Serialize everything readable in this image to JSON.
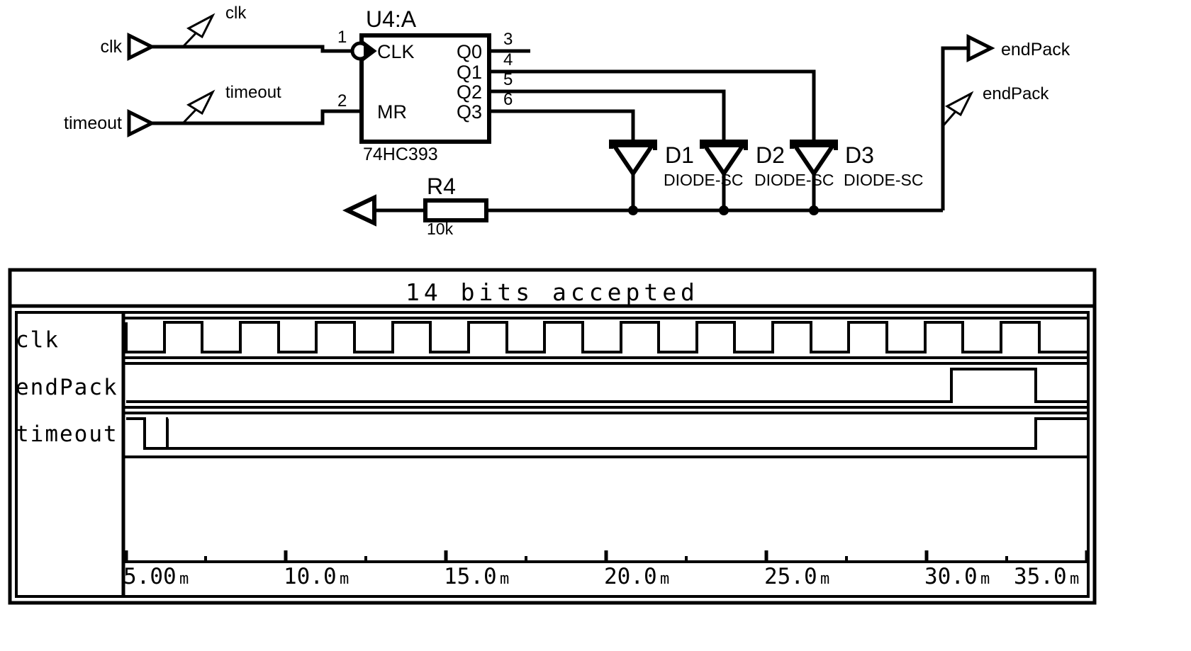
{
  "document": {
    "title": "74HC393 counter schematic with simulation timing diagram",
    "background_color": "#ffffff",
    "line_color": "#000000"
  },
  "schematic": {
    "ic": {
      "reference": "U4:A",
      "part_number": "74HC393",
      "input_pins": [
        {
          "name": "CLK",
          "number": "1",
          "inverted_clock": true
        },
        {
          "name": "MR",
          "number": "2",
          "inverted_clock": false
        }
      ],
      "output_pins": [
        {
          "name": "Q0",
          "number": "3"
        },
        {
          "name": "Q1",
          "number": "4"
        },
        {
          "name": "Q2",
          "number": "5"
        },
        {
          "name": "Q3",
          "number": "6"
        }
      ]
    },
    "input_terminals": [
      {
        "label": "clk",
        "net_label": "clk"
      },
      {
        "label": "timeout",
        "net_label": "timeout"
      }
    ],
    "output_terminals": [
      {
        "label": "endPack",
        "net_label": "endPack"
      }
    ],
    "diodes": [
      {
        "reference": "",
        "type": "DIODE-SC"
      },
      {
        "reference": "D1",
        "type": "DIODE-SC"
      },
      {
        "reference": "D2",
        "type": "DIODE-SC"
      },
      {
        "reference": "D3",
        "type": "DIODE-SC"
      }
    ],
    "resistor": {
      "reference": "R4",
      "value": "10k"
    }
  },
  "timing_diagram": {
    "title": "14 bits accepted",
    "signals": [
      {
        "name": "clk"
      },
      {
        "name": "endPack"
      },
      {
        "name": "timeout"
      }
    ],
    "time_axis": {
      "ticks": [
        "5.00",
        "10.0",
        "15.0",
        "20.0",
        "25.0",
        "30.0",
        "35.0"
      ],
      "unit": "m"
    }
  },
  "chart_data": {
    "type": "line",
    "title": "14 bits accepted",
    "xlabel": "",
    "ylabel": "",
    "xlim": [
      5.0,
      35.0
    ],
    "x_unit": "m",
    "x_ticks": [
      5.0,
      10.0,
      15.0,
      20.0,
      25.0,
      30.0,
      35.0
    ],
    "x_tick_labels": [
      "5.00m",
      "10.0m",
      "15.0m",
      "20.0m",
      "25.0m",
      "30.0m",
      "35.0m"
    ],
    "grid": false,
    "legend": "left-axis-labels",
    "series": [
      {
        "name": "clk",
        "type": "digital",
        "description": "Square wave clock, 14 rising edges across the window",
        "transitions": [
          {
            "t": 5.0,
            "level": 1
          },
          {
            "t": 6.07,
            "level": 0
          },
          {
            "t": 7.14,
            "level": 1
          },
          {
            "t": 8.21,
            "level": 0
          },
          {
            "t": 9.29,
            "level": 1
          },
          {
            "t": 10.36,
            "level": 0
          },
          {
            "t": 11.43,
            "level": 1
          },
          {
            "t": 12.5,
            "level": 0
          },
          {
            "t": 13.57,
            "level": 1
          },
          {
            "t": 14.64,
            "level": 0
          },
          {
            "t": 15.71,
            "level": 1
          },
          {
            "t": 16.79,
            "level": 0
          },
          {
            "t": 17.86,
            "level": 1
          },
          {
            "t": 18.93,
            "level": 0
          },
          {
            "t": 20.0,
            "level": 1
          },
          {
            "t": 21.07,
            "level": 0
          },
          {
            "t": 22.14,
            "level": 1
          },
          {
            "t": 23.21,
            "level": 0
          },
          {
            "t": 24.29,
            "level": 1
          },
          {
            "t": 25.36,
            "level": 0
          },
          {
            "t": 26.43,
            "level": 1
          },
          {
            "t": 27.5,
            "level": 0
          },
          {
            "t": 28.57,
            "level": 1
          },
          {
            "t": 29.64,
            "level": 0
          },
          {
            "t": 30.71,
            "level": 1
          },
          {
            "t": 31.79,
            "level": 0
          },
          {
            "t": 32.86,
            "level": 1
          },
          {
            "t": 33.93,
            "level": 0
          },
          {
            "t": 35.0,
            "level": 1
          }
        ]
      },
      {
        "name": "endPack",
        "type": "digital",
        "description": "Low until approximately 31.3m, pulses high until 34.6m, then low",
        "transitions": [
          {
            "t": 5.0,
            "level": 0
          },
          {
            "t": 31.3,
            "level": 1
          },
          {
            "t": 34.6,
            "level": 0
          },
          {
            "t": 35.0,
            "level": 0
          }
        ]
      },
      {
        "name": "timeout",
        "type": "digital",
        "description": "High pulse at start until about 5.8m, low, then high again from about 34.6m",
        "transitions": [
          {
            "t": 5.0,
            "level": 1
          },
          {
            "t": 5.8,
            "level": 0
          },
          {
            "t": 34.6,
            "level": 1
          },
          {
            "t": 35.0,
            "level": 1
          }
        ]
      }
    ]
  }
}
